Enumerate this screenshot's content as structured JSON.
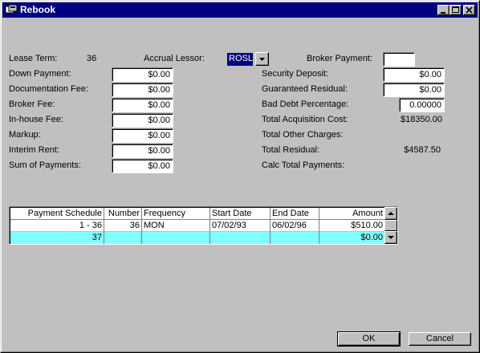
{
  "window": {
    "title": "Rebook"
  },
  "left_fields": [
    {
      "label": "Down Payment:",
      "value": "$0.00"
    },
    {
      "label": "Documentation Fee:",
      "value": "$0.00"
    },
    {
      "label": "Broker Fee:",
      "value": "$0.00"
    },
    {
      "label": "In-house Fee:",
      "value": "$0.00"
    },
    {
      "label": "Markup:",
      "value": "$0.00"
    },
    {
      "label": "Interim Rent:",
      "value": "$0.00"
    },
    {
      "label": "Sum of Payments:",
      "value": "$0.00"
    }
  ],
  "lease_term": {
    "label": "Lease Term:",
    "value": "36"
  },
  "accrual_lessor": {
    "label": "Accrual Lessor:",
    "value": "ROSL"
  },
  "broker_payment": {
    "label": "Broker Payment:",
    "value": ""
  },
  "right_fields": {
    "security_deposit": {
      "label": "Security Deposit:",
      "value": "$0.00"
    },
    "guaranteed_residual": {
      "label": "Guaranteed Residual:",
      "value": "$0.00"
    },
    "bad_debt_percentage": {
      "label": "Bad Debt Percentage:",
      "value": "0.00000"
    },
    "total_acquisition_cost": {
      "label": "Total Acquisition Cost:",
      "value": "$18350.00"
    },
    "total_other_charges": {
      "label": "Total Other Charges:",
      "value": ""
    },
    "total_residual": {
      "label": "Total Residual:",
      "value": "$4587.50"
    },
    "calc_total_payments": {
      "label": "Calc Total Payments:",
      "value": ""
    }
  },
  "schedule": {
    "columns": [
      "Payment Schedule",
      "Number",
      "Frequency",
      "Start Date",
      "End Date",
      "Amount"
    ],
    "rows": [
      [
        "1 -  36",
        "36",
        "MON",
        "07/02/93",
        "06/02/96",
        "$510.00"
      ],
      [
        "37",
        "",
        "",
        "",
        "",
        "$0.00"
      ]
    ]
  },
  "buttons": {
    "ok": "OK",
    "cancel": "Cancel"
  },
  "colors": {
    "titlebar": "#000080",
    "selected_row": "#80ffff",
    "window": "#c0c0c0"
  }
}
